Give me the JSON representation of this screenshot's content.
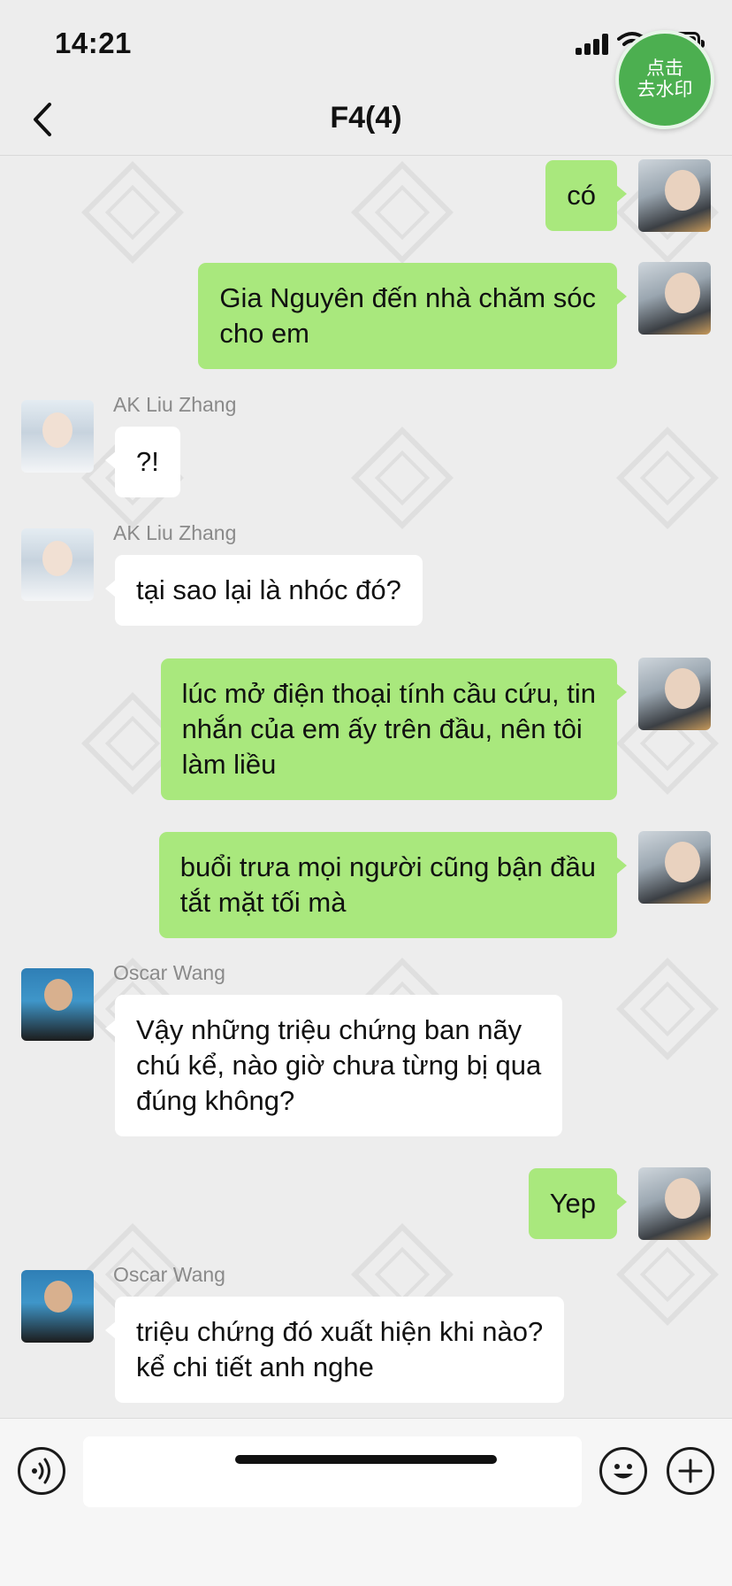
{
  "status_bar": {
    "time": "14:21"
  },
  "watermark_badge": {
    "line1": "点击",
    "line2": "去水印"
  },
  "navbar": {
    "title": "F4(4)"
  },
  "messages": [
    {
      "dir": "out",
      "text": "có"
    },
    {
      "dir": "out",
      "text": "Gia Nguyên đến nhà chăm sóc\ncho em"
    },
    {
      "dir": "in",
      "sender": "AK Liu Zhang",
      "text": "?!"
    },
    {
      "dir": "in",
      "sender": "AK Liu Zhang",
      "text": "tại sao lại là nhóc đó?"
    },
    {
      "dir": "out",
      "text": "lúc mở điện thoại tính cầu cứu, tin\nnhắn của em ấy trên đầu, nên tôi\nlàm liều"
    },
    {
      "dir": "out",
      "text": "buổi trưa mọi người cũng bận đầu\ntắt mặt tối mà"
    },
    {
      "dir": "in",
      "sender": "Oscar Wang",
      "text": "Vậy những triệu chứng ban nãy\nchú kể, nào giờ chưa từng bị qua\nđúng không?"
    },
    {
      "dir": "out",
      "text": "Yep"
    },
    {
      "dir": "in",
      "sender": "Oscar Wang",
      "text": "triệu chứng đó xuất hiện khi nào?\nkể chi tiết anh nghe"
    }
  ],
  "input_bar": {
    "message_value": ""
  },
  "icons": {
    "back": "chevron-left-icon",
    "voice": "voice-icon",
    "emoji": "emoji-icon",
    "plus": "plus-icon"
  },
  "colors": {
    "background": "#ededed",
    "outgoing_bubble": "#a9e87d",
    "incoming_bubble": "#ffffff",
    "sender_name": "#8a8a8a",
    "badge": "#4caf50"
  }
}
